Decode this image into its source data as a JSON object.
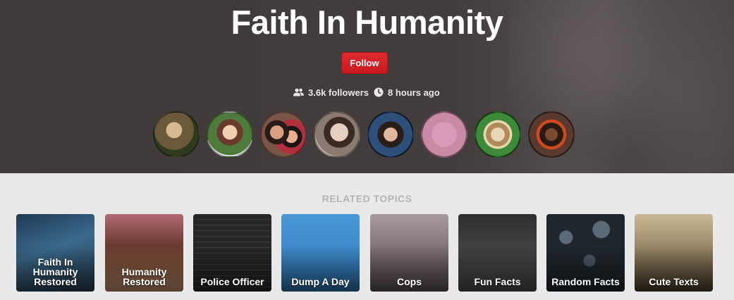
{
  "board": {
    "title": "Faith In Humanity",
    "follow_label": "Follow",
    "followers": "3.6k followers",
    "updated": "8 hours ago"
  },
  "avatars": [
    {
      "name": "avatar-1",
      "color": "#6b5a3a"
    },
    {
      "name": "avatar-2",
      "color": "#4e7a3c"
    },
    {
      "name": "avatar-3",
      "color": "#7a5548"
    },
    {
      "name": "avatar-4",
      "color": "#8a7a70"
    },
    {
      "name": "avatar-5",
      "color": "#2e4f7a"
    },
    {
      "name": "avatar-6",
      "color": "#c98aa6"
    },
    {
      "name": "avatar-7",
      "color": "#3f8a3a"
    },
    {
      "name": "avatar-8",
      "color": "#5a3a2e"
    }
  ],
  "related": {
    "heading": "RELATED TOPICS",
    "topics": [
      {
        "label": "Faith In Humanity Restored",
        "color": "#2d4d6d"
      },
      {
        "label": "Humanity Restored",
        "color": "#9a6a66"
      },
      {
        "label": "Police Officer",
        "color": "#2a2a2a"
      },
      {
        "label": "Dump A Day",
        "color": "#3a86c6"
      },
      {
        "label": "Cops",
        "color": "#8a7a7e"
      },
      {
        "label": "Fun Facts",
        "color": "#3c3c3c"
      },
      {
        "label": "Random Facts",
        "color": "#2f3a44"
      },
      {
        "label": "Cute Texts",
        "color": "#8a7a5a"
      }
    ]
  }
}
